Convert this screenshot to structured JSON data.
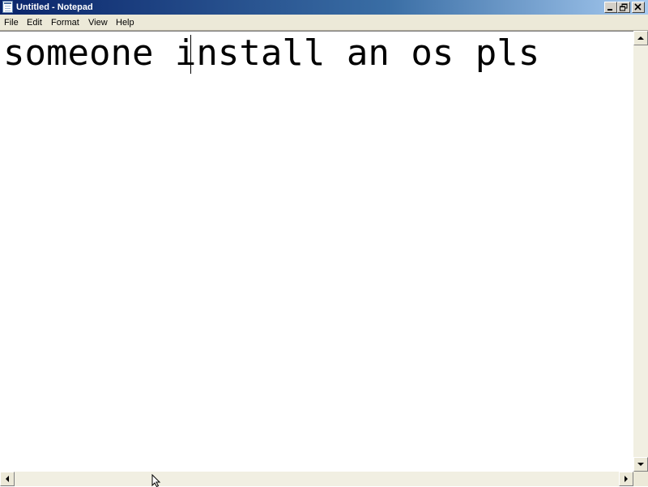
{
  "window": {
    "title": "Untitled - Notepad",
    "icon": "notepad-icon",
    "controls": [
      "minimize-icon",
      "restore-icon",
      "close-icon"
    ]
  },
  "menu": {
    "items": [
      {
        "label": "File"
      },
      {
        "label": "Edit"
      },
      {
        "label": "Format"
      },
      {
        "label": "View"
      },
      {
        "label": "Help"
      }
    ]
  },
  "editor": {
    "text": "someone install an os pls"
  },
  "colors": {
    "title_gradient_start": "#0a246a",
    "title_gradient_end": "#a6caf0",
    "menu_bg": "#ece9d8",
    "editor_bg": "#ffffff",
    "text": "#000000"
  }
}
